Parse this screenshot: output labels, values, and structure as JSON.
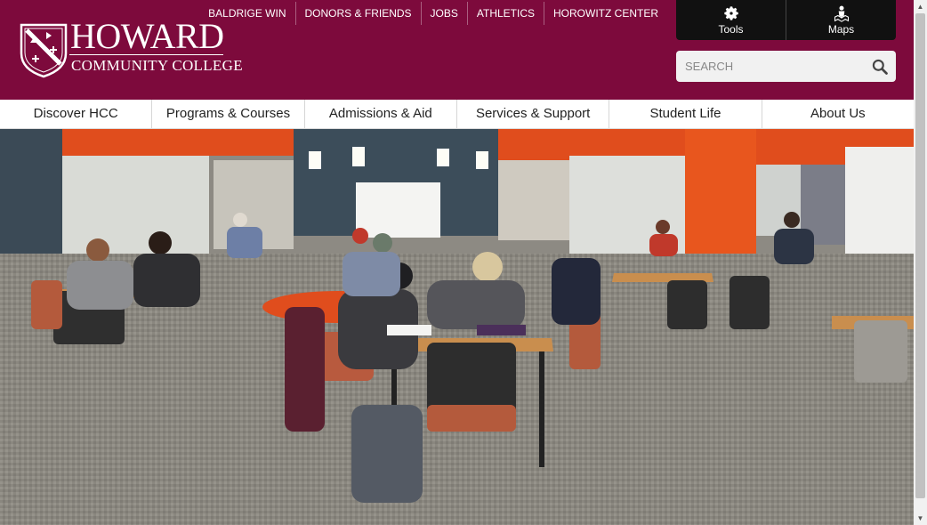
{
  "site": {
    "name": "HOWARD",
    "subtitle": "COMMUNITY COLLEGE"
  },
  "top_links": [
    "BALDRIGE WIN",
    "DONORS & FRIENDS",
    "JOBS",
    "ATHLETICS",
    "HOROWITZ CENTER"
  ],
  "tools": {
    "tools_label": "Tools",
    "maps_label": "Maps"
  },
  "search": {
    "placeholder": "SEARCH"
  },
  "nav": [
    "Discover HCC",
    "Programs & Courses",
    "Admissions & Aid",
    "Services & Support",
    "Student Life",
    "About Us"
  ],
  "colors": {
    "brand": "#7d0a3c",
    "tools_bg": "#111111",
    "accent_orange": "#e8531f"
  },
  "icons": {
    "tools": "gear-icon",
    "maps": "map-person-icon",
    "search": "magnifier-icon"
  }
}
